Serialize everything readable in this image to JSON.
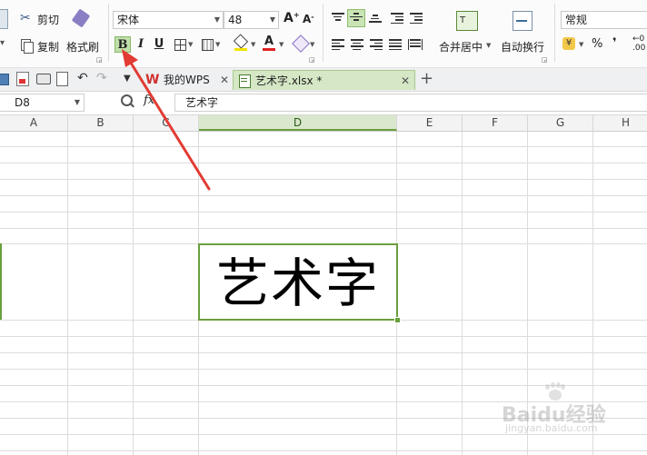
{
  "ribbon": {
    "clipboard": {
      "cut": "剪切",
      "copy": "复制",
      "format_painter": "格式刷"
    },
    "font": {
      "name": "宋体",
      "size": "48"
    },
    "format_buttons": {
      "bold": "B",
      "italic": "I",
      "underline": "U",
      "font_color": "A"
    },
    "alignment": {
      "merge_center": "合并居中",
      "wrap_text": "自动换行"
    },
    "number": {
      "format": "常规",
      "currency": "¥",
      "percent": "%",
      "comma": "❜",
      "decimal": ".00"
    }
  },
  "tabs": [
    {
      "label": "我的WPS",
      "active": false
    },
    {
      "label": "艺术字.xlsx *",
      "active": true
    }
  ],
  "formula_bar": {
    "cell_ref": "D8",
    "fx": "fx",
    "content": "艺术字"
  },
  "columns": [
    "A",
    "B",
    "C",
    "D",
    "E",
    "F",
    "G",
    "H"
  ],
  "selected_column": "D",
  "cell": {
    "text": "艺术字"
  },
  "watermark": {
    "text": "Baidu经验",
    "url": "jingyan.baidu.com"
  },
  "colors": {
    "accent_green": "#6a9e3d",
    "arrow_red": "#e23b33",
    "wps_red": "#d0312d"
  }
}
